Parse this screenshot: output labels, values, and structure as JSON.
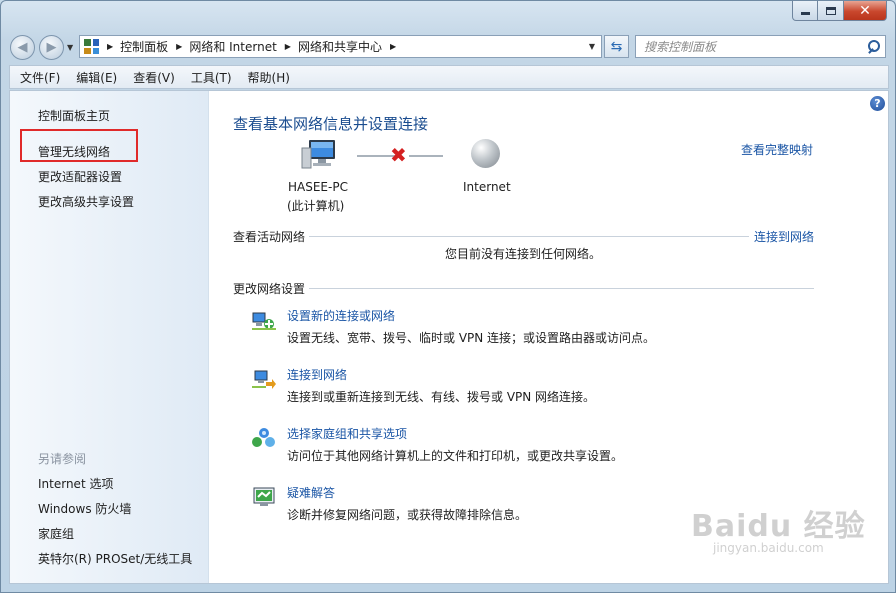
{
  "breadcrumb": [
    "控制面板",
    "网络和 Internet",
    "网络和共享中心"
  ],
  "search": {
    "placeholder": "搜索控制面板"
  },
  "menu": [
    "文件(F)",
    "编辑(E)",
    "查看(V)",
    "工具(T)",
    "帮助(H)"
  ],
  "sidebar": {
    "items": [
      "控制面板主页",
      "管理无线网络",
      "更改适配器设置",
      "更改高级共享设置"
    ],
    "see_also_heading": "另请参阅",
    "see_also": [
      "Internet 选项",
      "Windows 防火墙",
      "家庭组",
      "英特尔(R) PROSet/无线工具"
    ]
  },
  "main": {
    "title": "查看基本网络信息并设置连接",
    "view_full_map": "查看完整映射",
    "computer_name": "HASEE-PC",
    "computer_sub": "(此计算机)",
    "internet_label": "Internet",
    "active_networks_title": "查看活动网络",
    "connect_link": "连接到网络",
    "no_network_text": "您目前没有连接到任何网络。",
    "change_settings_title": "更改网络设置",
    "tasks": [
      {
        "link": "设置新的连接或网络",
        "desc": "设置无线、宽带、拨号、临时或 VPN 连接；或设置路由器或访问点。"
      },
      {
        "link": "连接到网络",
        "desc": "连接到或重新连接到无线、有线、拨号或 VPN 网络连接。"
      },
      {
        "link": "选择家庭组和共享选项",
        "desc": "访问位于其他网络计算机上的文件和打印机，或更改共享设置。"
      },
      {
        "link": "疑难解答",
        "desc": "诊断并修复网络问题，或获得故障排除信息。"
      }
    ]
  },
  "watermark": {
    "brand": "Baidu 经验",
    "url": "jingyan.baidu.com"
  },
  "colors": {
    "link": "#1a55a5",
    "title": "#1a4c8f",
    "highlight_box": "#e02a2a",
    "disconnect_x": "#d42020"
  }
}
